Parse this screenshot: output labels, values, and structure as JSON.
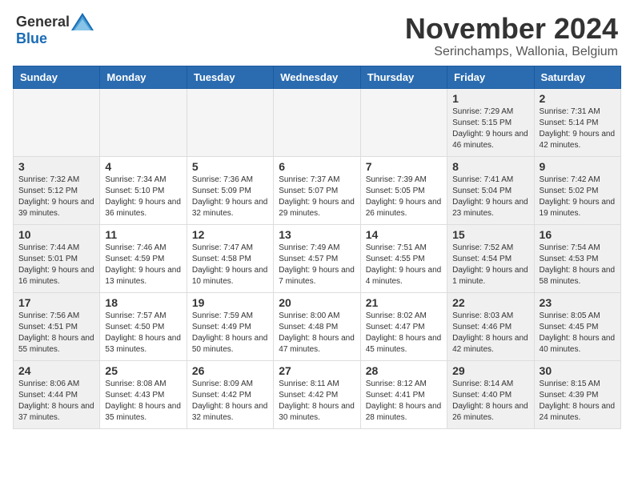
{
  "header": {
    "logo_general": "General",
    "logo_blue": "Blue",
    "month_title": "November 2024",
    "location": "Serinchamps, Wallonia, Belgium"
  },
  "days_of_week": [
    "Sunday",
    "Monday",
    "Tuesday",
    "Wednesday",
    "Thursday",
    "Friday",
    "Saturday"
  ],
  "weeks": [
    [
      {
        "num": "",
        "info": "",
        "empty": true
      },
      {
        "num": "",
        "info": "",
        "empty": true
      },
      {
        "num": "",
        "info": "",
        "empty": true
      },
      {
        "num": "",
        "info": "",
        "empty": true
      },
      {
        "num": "",
        "info": "",
        "empty": true
      },
      {
        "num": "1",
        "info": "Sunrise: 7:29 AM\nSunset: 5:15 PM\nDaylight: 9 hours and 46 minutes.",
        "empty": false,
        "weekend": true
      },
      {
        "num": "2",
        "info": "Sunrise: 7:31 AM\nSunset: 5:14 PM\nDaylight: 9 hours and 42 minutes.",
        "empty": false,
        "weekend": true
      }
    ],
    [
      {
        "num": "3",
        "info": "Sunrise: 7:32 AM\nSunset: 5:12 PM\nDaylight: 9 hours and 39 minutes.",
        "empty": false,
        "weekend": true
      },
      {
        "num": "4",
        "info": "Sunrise: 7:34 AM\nSunset: 5:10 PM\nDaylight: 9 hours and 36 minutes.",
        "empty": false
      },
      {
        "num": "5",
        "info": "Sunrise: 7:36 AM\nSunset: 5:09 PM\nDaylight: 9 hours and 32 minutes.",
        "empty": false
      },
      {
        "num": "6",
        "info": "Sunrise: 7:37 AM\nSunset: 5:07 PM\nDaylight: 9 hours and 29 minutes.",
        "empty": false
      },
      {
        "num": "7",
        "info": "Sunrise: 7:39 AM\nSunset: 5:05 PM\nDaylight: 9 hours and 26 minutes.",
        "empty": false
      },
      {
        "num": "8",
        "info": "Sunrise: 7:41 AM\nSunset: 5:04 PM\nDaylight: 9 hours and 23 minutes.",
        "empty": false,
        "weekend": true
      },
      {
        "num": "9",
        "info": "Sunrise: 7:42 AM\nSunset: 5:02 PM\nDaylight: 9 hours and 19 minutes.",
        "empty": false,
        "weekend": true
      }
    ],
    [
      {
        "num": "10",
        "info": "Sunrise: 7:44 AM\nSunset: 5:01 PM\nDaylight: 9 hours and 16 minutes.",
        "empty": false,
        "weekend": true
      },
      {
        "num": "11",
        "info": "Sunrise: 7:46 AM\nSunset: 4:59 PM\nDaylight: 9 hours and 13 minutes.",
        "empty": false
      },
      {
        "num": "12",
        "info": "Sunrise: 7:47 AM\nSunset: 4:58 PM\nDaylight: 9 hours and 10 minutes.",
        "empty": false
      },
      {
        "num": "13",
        "info": "Sunrise: 7:49 AM\nSunset: 4:57 PM\nDaylight: 9 hours and 7 minutes.",
        "empty": false
      },
      {
        "num": "14",
        "info": "Sunrise: 7:51 AM\nSunset: 4:55 PM\nDaylight: 9 hours and 4 minutes.",
        "empty": false
      },
      {
        "num": "15",
        "info": "Sunrise: 7:52 AM\nSunset: 4:54 PM\nDaylight: 9 hours and 1 minute.",
        "empty": false,
        "weekend": true
      },
      {
        "num": "16",
        "info": "Sunrise: 7:54 AM\nSunset: 4:53 PM\nDaylight: 8 hours and 58 minutes.",
        "empty": false,
        "weekend": true
      }
    ],
    [
      {
        "num": "17",
        "info": "Sunrise: 7:56 AM\nSunset: 4:51 PM\nDaylight: 8 hours and 55 minutes.",
        "empty": false,
        "weekend": true
      },
      {
        "num": "18",
        "info": "Sunrise: 7:57 AM\nSunset: 4:50 PM\nDaylight: 8 hours and 53 minutes.",
        "empty": false
      },
      {
        "num": "19",
        "info": "Sunrise: 7:59 AM\nSunset: 4:49 PM\nDaylight: 8 hours and 50 minutes.",
        "empty": false
      },
      {
        "num": "20",
        "info": "Sunrise: 8:00 AM\nSunset: 4:48 PM\nDaylight: 8 hours and 47 minutes.",
        "empty": false
      },
      {
        "num": "21",
        "info": "Sunrise: 8:02 AM\nSunset: 4:47 PM\nDaylight: 8 hours and 45 minutes.",
        "empty": false
      },
      {
        "num": "22",
        "info": "Sunrise: 8:03 AM\nSunset: 4:46 PM\nDaylight: 8 hours and 42 minutes.",
        "empty": false,
        "weekend": true
      },
      {
        "num": "23",
        "info": "Sunrise: 8:05 AM\nSunset: 4:45 PM\nDaylight: 8 hours and 40 minutes.",
        "empty": false,
        "weekend": true
      }
    ],
    [
      {
        "num": "24",
        "info": "Sunrise: 8:06 AM\nSunset: 4:44 PM\nDaylight: 8 hours and 37 minutes.",
        "empty": false,
        "weekend": true
      },
      {
        "num": "25",
        "info": "Sunrise: 8:08 AM\nSunset: 4:43 PM\nDaylight: 8 hours and 35 minutes.",
        "empty": false
      },
      {
        "num": "26",
        "info": "Sunrise: 8:09 AM\nSunset: 4:42 PM\nDaylight: 8 hours and 32 minutes.",
        "empty": false
      },
      {
        "num": "27",
        "info": "Sunrise: 8:11 AM\nSunset: 4:42 PM\nDaylight: 8 hours and 30 minutes.",
        "empty": false
      },
      {
        "num": "28",
        "info": "Sunrise: 8:12 AM\nSunset: 4:41 PM\nDaylight: 8 hours and 28 minutes.",
        "empty": false
      },
      {
        "num": "29",
        "info": "Sunrise: 8:14 AM\nSunset: 4:40 PM\nDaylight: 8 hours and 26 minutes.",
        "empty": false,
        "weekend": true
      },
      {
        "num": "30",
        "info": "Sunrise: 8:15 AM\nSunset: 4:39 PM\nDaylight: 8 hours and 24 minutes.",
        "empty": false,
        "weekend": true
      }
    ]
  ]
}
